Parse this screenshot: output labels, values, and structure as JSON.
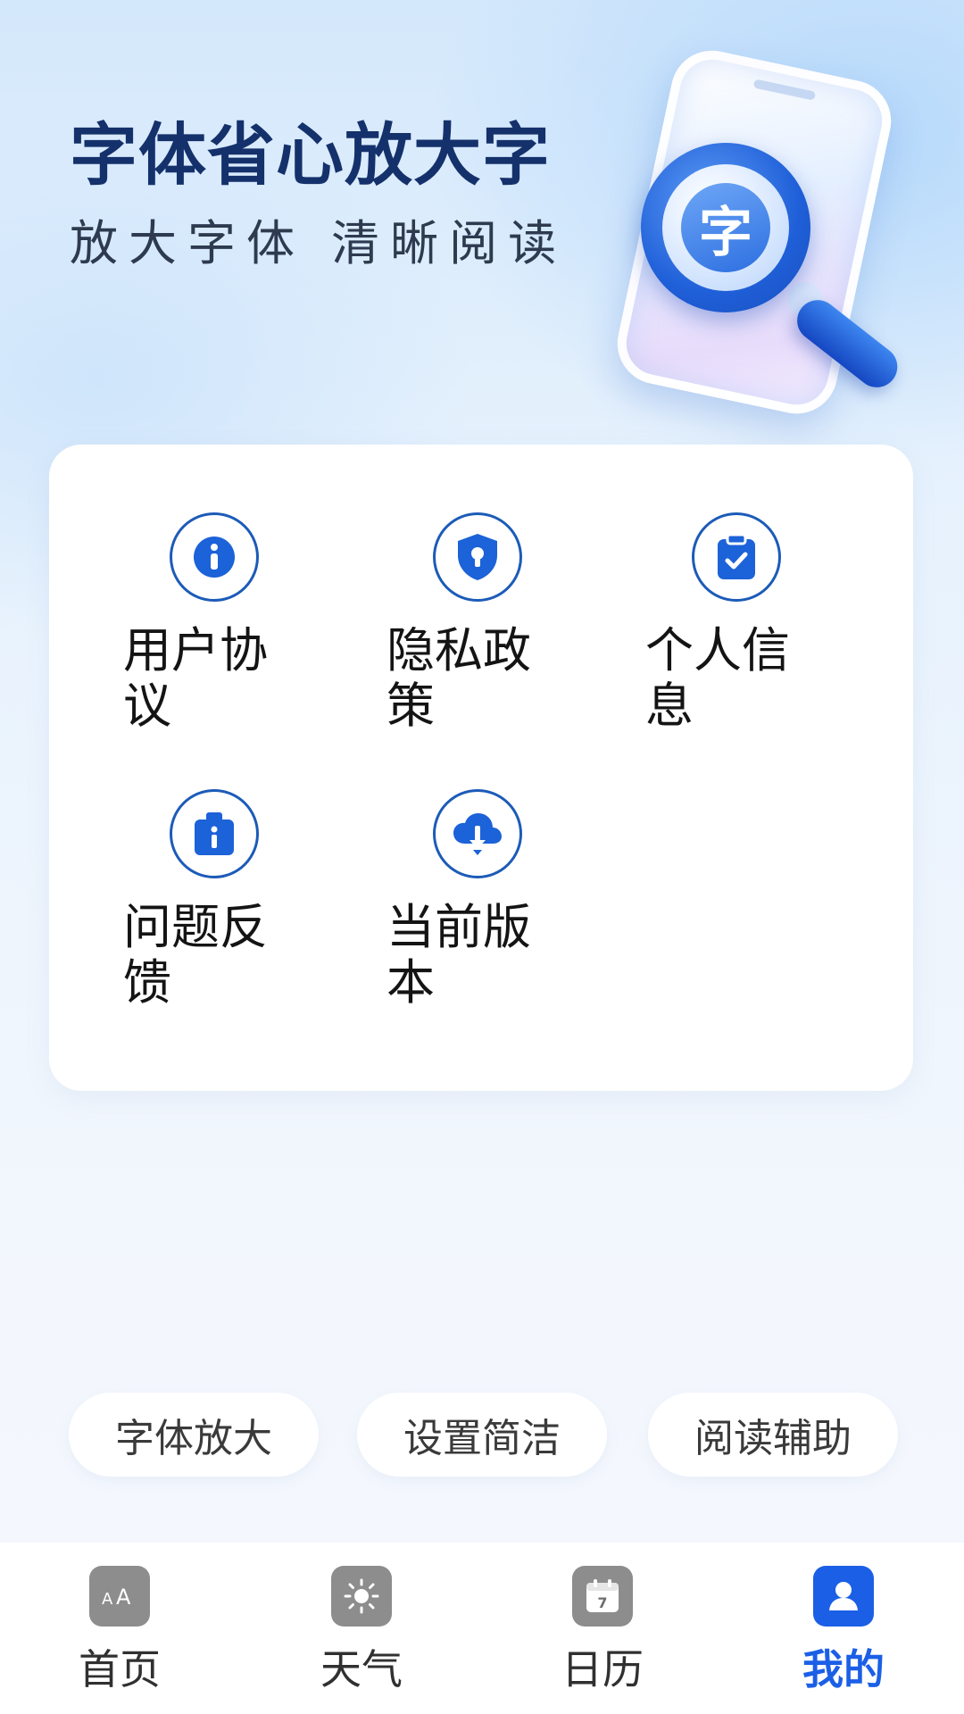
{
  "header": {
    "title": "字体省心放大字",
    "subtitle": "放大字体  清晰阅读",
    "illustration_glyph": "字"
  },
  "menu": {
    "items": [
      {
        "label": "用户协议",
        "icon": "info-icon"
      },
      {
        "label": "隐私政策",
        "icon": "shield-icon"
      },
      {
        "label": "个人信息",
        "icon": "clipboard-check-icon"
      },
      {
        "label": "问题反馈",
        "icon": "feedback-box-icon"
      },
      {
        "label": "当前版本",
        "icon": "cloud-download-icon"
      }
    ]
  },
  "chips": [
    "字体放大",
    "设置简洁",
    "阅读辅助"
  ],
  "tabbar": {
    "tabs": [
      {
        "label": "首页",
        "icon": "font-size-icon",
        "active": false
      },
      {
        "label": "天气",
        "icon": "sun-icon",
        "active": false
      },
      {
        "label": "日历",
        "icon": "calendar-icon",
        "active": false,
        "icon_text": "7"
      },
      {
        "label": "我的",
        "icon": "user-icon",
        "active": true
      }
    ]
  },
  "colors": {
    "accent": "#1b5fe6",
    "icon_blue": "#1c5bb8",
    "title": "#15316b",
    "inactive_tab": "#8d8d8d"
  }
}
